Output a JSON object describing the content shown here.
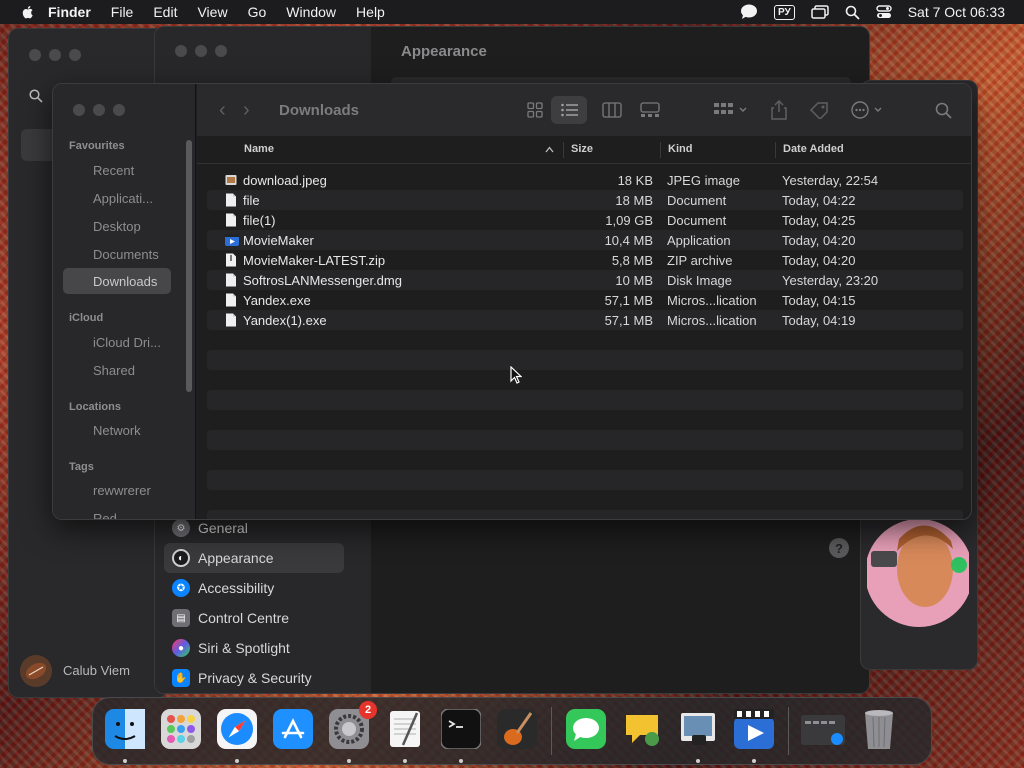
{
  "menubar": {
    "app_name": "Finder",
    "items": [
      "File",
      "Edit",
      "View",
      "Go",
      "Window",
      "Help"
    ],
    "input_source": "РУ",
    "datetime": "Sat 7 Oct  06:33"
  },
  "settings_window": {
    "title": "Appearance",
    "sidebar_items": [
      {
        "label": "General",
        "color": "#8e8e93"
      },
      {
        "label": "Appearance",
        "color": "#1c1c1e",
        "selected": true
      },
      {
        "label": "Accessibility",
        "color": "#0a84ff"
      },
      {
        "label": "Control Centre",
        "color": "#8e8e93"
      },
      {
        "label": "Siri & Spotlight",
        "color": "#bf5af2"
      },
      {
        "label": "Privacy & Security",
        "color": "#0a84ff"
      }
    ],
    "user_name": "Calub Viem",
    "help_label": "?"
  },
  "finder": {
    "title": "Downloads",
    "sidebar": {
      "sections": [
        {
          "label": "Favourites",
          "items": [
            "Recent",
            "Applicati...",
            "Desktop",
            "Documents",
            "Downloads"
          ]
        },
        {
          "label": "iCloud",
          "items": [
            "iCloud Dri...",
            "Shared"
          ]
        },
        {
          "label": "Locations",
          "items": [
            "Network"
          ]
        },
        {
          "label": "Tags",
          "items": [
            "rewwrerer",
            "Red"
          ]
        }
      ],
      "selected": "Downloads"
    },
    "columns": {
      "name": "Name",
      "size": "Size",
      "kind": "Kind",
      "date": "Date Added"
    },
    "files": [
      {
        "name": "download.jpeg",
        "size": "18 KB",
        "kind": "JPEG image",
        "date": "Yesterday, 22:54",
        "icon": "image"
      },
      {
        "name": "file",
        "size": "18 MB",
        "kind": "Document",
        "date": "Today, 04:22",
        "icon": "doc"
      },
      {
        "name": "file(1)",
        "size": "1,09 GB",
        "kind": "Document",
        "date": "Today, 04:25",
        "icon": "doc"
      },
      {
        "name": "MovieMaker",
        "size": "10,4 MB",
        "kind": "Application",
        "date": "Today, 04:20",
        "icon": "app"
      },
      {
        "name": "MovieMaker-LATEST.zip",
        "size": "5,8 MB",
        "kind": "ZIP archive",
        "date": "Today, 04:20",
        "icon": "zip"
      },
      {
        "name": "SoftrosLANMessenger.dmg",
        "size": "10 MB",
        "kind": "Disk Image",
        "date": "Yesterday, 23:20",
        "icon": "doc"
      },
      {
        "name": "Yandex.exe",
        "size": "57,1 MB",
        "kind": "Micros...lication",
        "date": "Today, 04:15",
        "icon": "doc"
      },
      {
        "name": "Yandex(1).exe",
        "size": "57,1 MB",
        "kind": "Micros...lication",
        "date": "Today, 04:19",
        "icon": "doc"
      }
    ]
  },
  "dock": {
    "apps": [
      {
        "name": "finder",
        "color": "#1e88e5",
        "running": true
      },
      {
        "name": "launchpad",
        "color": "#d0d0d0",
        "running": false
      },
      {
        "name": "safari",
        "color": "#1a8cff",
        "running": true
      },
      {
        "name": "app-store",
        "color": "#1e90ff",
        "running": false
      },
      {
        "name": "system-settings",
        "color": "#8e8e93",
        "running": true,
        "badge": "2"
      },
      {
        "name": "textedit",
        "color": "#f5f5f5",
        "running": true
      },
      {
        "name": "terminal",
        "color": "#111111",
        "running": true
      },
      {
        "name": "garageband",
        "color": "#2a2a2a",
        "running": false
      }
    ],
    "recent": [
      {
        "name": "messages",
        "color": "#34c759",
        "running": false
      },
      {
        "name": "speech-app",
        "color": "#f2c230",
        "running": false
      },
      {
        "name": "preview",
        "color": "#6a8fb5",
        "running": true
      },
      {
        "name": "moviemaker",
        "color": "#2b6fd6",
        "running": true
      }
    ],
    "others": [
      {
        "name": "screenshot-folder",
        "color": "#3a3a3c"
      },
      {
        "name": "trash",
        "color": "#8e8e93"
      }
    ]
  }
}
